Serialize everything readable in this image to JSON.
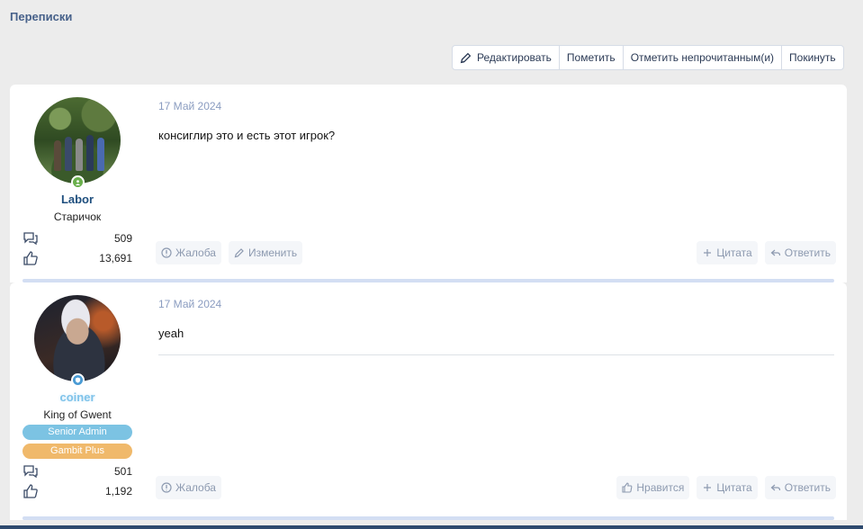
{
  "page": {
    "title": "Переписки"
  },
  "toolbar": {
    "edit": "Редактировать",
    "mark": "Пометить",
    "mark_unread": "Отметить непрочитанным(и)",
    "leave": "Покинуть"
  },
  "messages": [
    {
      "user": {
        "name": "Labor",
        "title": "Старичок",
        "messages": "509",
        "reactions": "13,691"
      },
      "date": "17 Май 2024",
      "text": "консиглир это и есть этот игрок?",
      "actions_left": [
        "Жалоба",
        "Изменить"
      ],
      "actions_right": [
        "Цитата",
        "Ответить"
      ]
    },
    {
      "user": {
        "name": "coiner",
        "title": "King of Gwent",
        "banners": [
          "Senior Admin",
          "Gambit Plus"
        ],
        "messages": "501",
        "reactions": "1,192"
      },
      "date": "17 Май 2024",
      "text": "yeah",
      "actions_left": [
        "Жалоба"
      ],
      "actions_right": [
        "Нравится",
        "Цитата",
        "Ответить"
      ]
    }
  ],
  "colors": {
    "accent": "#47618a",
    "status_online": "#6ab04c",
    "staff": "#4a9bd4",
    "admin_banner": "#7cc3e3",
    "plus_banner": "#f0b96b"
  }
}
